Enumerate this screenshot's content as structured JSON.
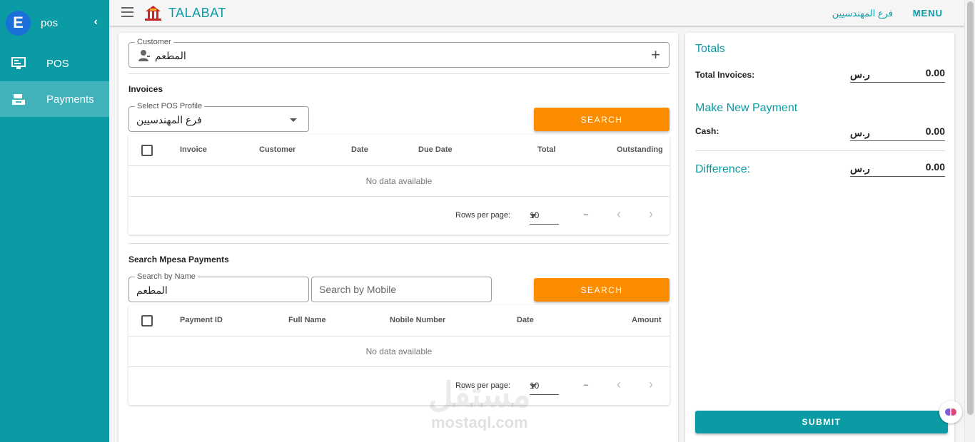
{
  "sidebar": {
    "logo_letter": "E",
    "title": "pos",
    "collapse_glyph": "‹",
    "items": [
      {
        "label": "POS",
        "icon": "monitor-icon",
        "active": false
      },
      {
        "label": "Payments",
        "icon": "bank-icon",
        "active": true
      }
    ]
  },
  "topbar": {
    "brand": "TALABAT",
    "brand_icon": "restaurant-logo-icon",
    "branch": "فرع المهندسيين",
    "menu_label": "MENU"
  },
  "customer": {
    "label": "Customer",
    "value": "المطعم"
  },
  "invoices": {
    "title": "Invoices",
    "pos_profile_label": "Select POS Profile",
    "pos_profile_value": "فرع المهندسيين",
    "search_label": "SEARCH",
    "columns": [
      "Invoice",
      "Customer",
      "Date",
      "Due Date",
      "Total",
      "Outstanding"
    ],
    "empty_text": "No data available",
    "rows_per_page_label": "Rows per page:",
    "rows_per_page": "10",
    "range": "–"
  },
  "mpesa": {
    "title": "Search Mpesa Payments",
    "name_label": "Search by Name",
    "name_value": "المطعم",
    "mobile_placeholder": "Search by Mobile",
    "search_label": "SEARCH",
    "columns": [
      "Payment ID",
      "Full Name",
      "Nobile Number",
      "Date",
      "Amount"
    ],
    "empty_text": "No data available",
    "rows_per_page_label": "Rows per page:",
    "rows_per_page": "10",
    "range": "–"
  },
  "totals": {
    "title": "Totals",
    "total_invoices_label": "Total Invoices:",
    "currency": "ر.س",
    "total_invoices_value": "0.00",
    "new_payment_title": "Make New Payment",
    "cash_label": "Cash:",
    "cash_value": "0.00",
    "difference_label": "Difference:",
    "difference_value": "0.00",
    "submit_label": "SUBMIT"
  },
  "watermark": {
    "arabic": "مستقل",
    "latin": "mostaql.com"
  },
  "colors": {
    "primary": "#0a9ba5",
    "accent": "#fb8c00"
  }
}
